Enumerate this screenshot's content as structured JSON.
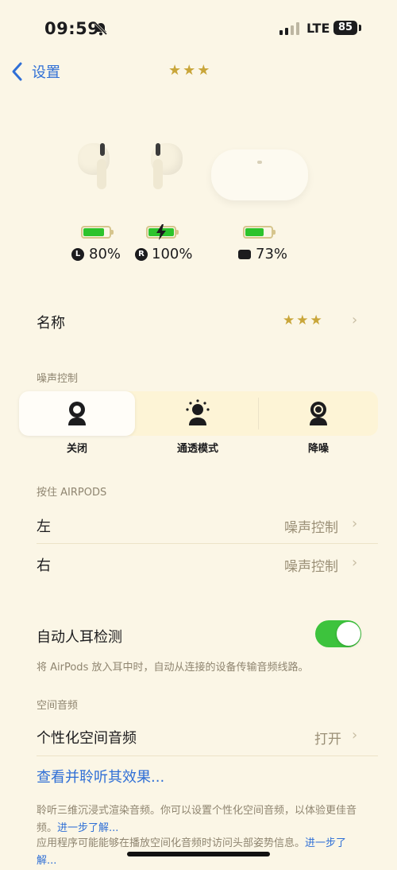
{
  "status_bar": {
    "time": "09:59",
    "network": "LTE",
    "battery": "85"
  },
  "nav": {
    "back_label": "设置",
    "title": "★★★"
  },
  "batteries": {
    "left": {
      "letter": "L",
      "percent": "80%",
      "level": 0.8
    },
    "right": {
      "letter": "R",
      "percent": "100%",
      "level": 1.0,
      "charging": true
    },
    "case": {
      "percent": "73%",
      "level": 0.73
    }
  },
  "name_row": {
    "label": "名称",
    "value": "★★★"
  },
  "noise_control": {
    "section_title": "噪声控制",
    "options": [
      {
        "label": "关闭",
        "icon": "person-off-icon",
        "selected": true
      },
      {
        "label": "通透模式",
        "icon": "person-transparency-icon",
        "selected": false
      },
      {
        "label": "降噪",
        "icon": "person-noise-cancel-icon",
        "selected": false
      }
    ]
  },
  "press_hold": {
    "section_title": "按住 AIRPODS",
    "left": {
      "label": "左",
      "value": "噪声控制"
    },
    "right": {
      "label": "右",
      "value": "噪声控制"
    }
  },
  "ear_detection": {
    "label": "自动人耳检测",
    "enabled": true,
    "description": "将 AirPods 放入耳中时，自动从连接的设备传输音频线路。"
  },
  "spatial_audio": {
    "section_title": "空间音频",
    "personalized": {
      "label": "个性化空间音频",
      "value": "打开"
    },
    "see_hear_link": "查看并聆听其效果...",
    "desc1": "聆听三维沉浸式渲染音频。你可以设置个性化空间音频，以体验更佳音频。",
    "desc1_link": "进一步了解...",
    "desc2": "应用程序可能能够在播放空间化音频时访问头部姿势信息。",
    "desc2_link": "进一步了解..."
  },
  "colors": {
    "accent": "#2f6fd6",
    "toggle_on": "#3dc33d",
    "battery_green": "#2cc32c"
  }
}
